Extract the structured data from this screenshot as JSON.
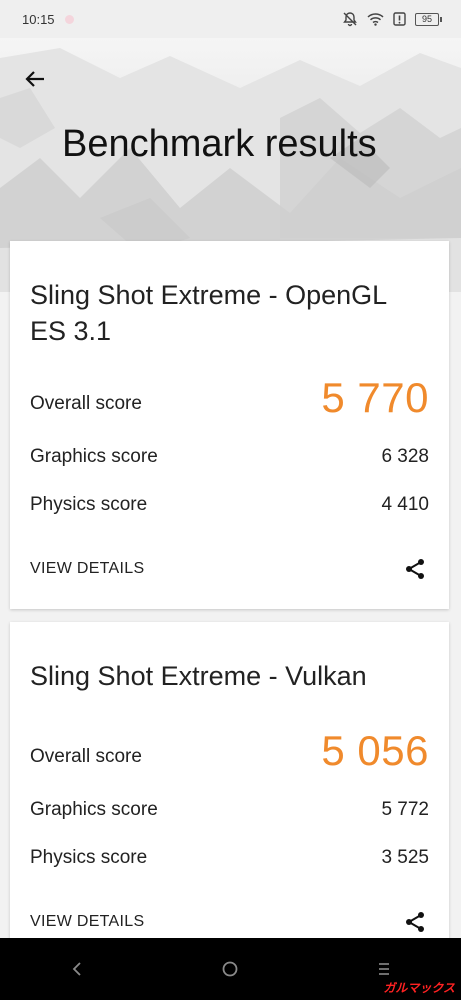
{
  "status_bar": {
    "time": "10:15",
    "battery_level": "95",
    "icons": [
      "notification-dot-icon",
      "silent-bell-icon",
      "wifi-icon",
      "alert-icon",
      "battery-icon"
    ]
  },
  "header": {
    "title": "Benchmark results",
    "back_icon": "arrow-left-icon"
  },
  "cards": [
    {
      "title": "Sling Shot Extreme - OpenGL ES 3.1",
      "overall_label": "Overall score",
      "overall_value": "5 770",
      "graphics_label": "Graphics score",
      "graphics_value": "6 328",
      "physics_label": "Physics score",
      "physics_value": "4 410",
      "details_label": "VIEW DETAILS",
      "share_icon": "share-icon"
    },
    {
      "title": "Sling Shot Extreme - Vulkan",
      "overall_label": "Overall score",
      "overall_value": "5 056",
      "graphics_label": "Graphics score",
      "graphics_value": "5 772",
      "physics_label": "Physics score",
      "physics_value": "3 525",
      "details_label": "VIEW DETAILS",
      "share_icon": "share-icon"
    }
  ],
  "nav_bar": {
    "icons": [
      "back-chevron-icon",
      "home-circle-icon",
      "menu-lines-icon"
    ]
  },
  "watermark": "ガルマックス",
  "colors": {
    "accent_orange": "#f08a2c",
    "nav_background": "#000000",
    "card_background": "#ffffff",
    "page_background": "#f2f2f2"
  }
}
